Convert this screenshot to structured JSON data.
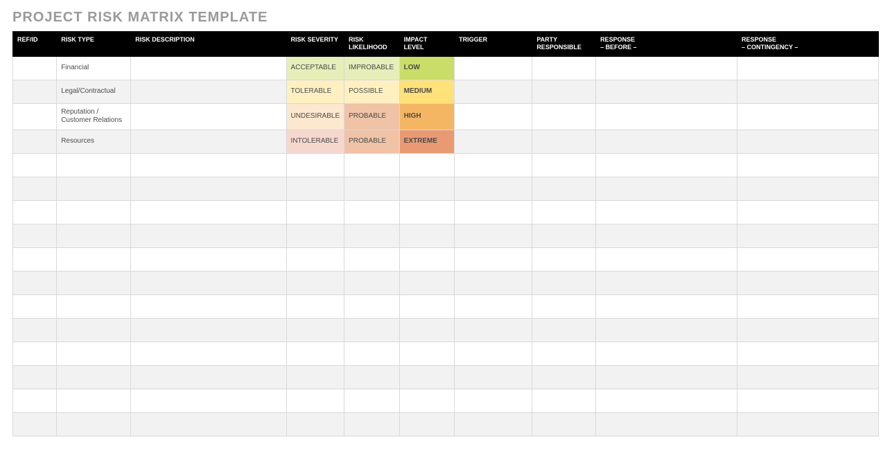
{
  "title": "PROJECT RISK MATRIX TEMPLATE",
  "columns": [
    "REF/ID",
    "RISK TYPE",
    "RISK DESCRIPTION",
    "RISK SEVERITY",
    "RISK LIKELIHOOD",
    "IMPACT LEVEL",
    "TRIGGER",
    "PARTY RESPONSIBLE",
    "RESPONSE – BEFORE –",
    "RESPONSE – CONTINGENCY –"
  ],
  "rows": [
    {
      "ref": "",
      "type": "Financial",
      "desc": "",
      "severity": "ACCEPTABLE",
      "likelihood": "IMPROBABLE",
      "impact": "LOW",
      "sev_bg": "#e6eeb9",
      "lik_bg": "#e6eeb9",
      "imp_bg": "#cadd68",
      "trigger": "",
      "party": "",
      "before": "",
      "contingency": ""
    },
    {
      "ref": "",
      "type": "Legal/Contractual",
      "desc": "",
      "severity": "TOLERABLE",
      "likelihood": "POSSIBLE",
      "impact": "MEDIUM",
      "sev_bg": "#fff0c2",
      "lik_bg": "#fff0c2",
      "imp_bg": "#ffe179",
      "trigger": "",
      "party": "",
      "before": "",
      "contingency": ""
    },
    {
      "ref": "",
      "type": "Reputation / Customer Relations",
      "desc": "",
      "severity": "UNDESIRABLE",
      "likelihood": "PROBABLE",
      "impact": "HIGH",
      "sev_bg": "#fce7cf",
      "lik_bg": "#f0c3a7",
      "imp_bg": "#f5b664",
      "trigger": "",
      "party": "",
      "before": "",
      "contingency": ""
    },
    {
      "ref": "",
      "type": "Resources",
      "desc": "",
      "severity": "INTOLERABLE",
      "likelihood": "PROBABLE",
      "impact": "EXTREME",
      "sev_bg": "#f6d7ce",
      "lik_bg": "#f0c3a7",
      "imp_bg": "#ea9a72",
      "trigger": "",
      "party": "",
      "before": "",
      "contingency": ""
    },
    {
      "ref": "",
      "type": "",
      "desc": "",
      "severity": "",
      "likelihood": "",
      "impact": "",
      "sev_bg": "",
      "lik_bg": "",
      "imp_bg": "",
      "trigger": "",
      "party": "",
      "before": "",
      "contingency": ""
    },
    {
      "ref": "",
      "type": "",
      "desc": "",
      "severity": "",
      "likelihood": "",
      "impact": "",
      "sev_bg": "",
      "lik_bg": "",
      "imp_bg": "",
      "trigger": "",
      "party": "",
      "before": "",
      "contingency": ""
    },
    {
      "ref": "",
      "type": "",
      "desc": "",
      "severity": "",
      "likelihood": "",
      "impact": "",
      "sev_bg": "",
      "lik_bg": "",
      "imp_bg": "",
      "trigger": "",
      "party": "",
      "before": "",
      "contingency": ""
    },
    {
      "ref": "",
      "type": "",
      "desc": "",
      "severity": "",
      "likelihood": "",
      "impact": "",
      "sev_bg": "",
      "lik_bg": "",
      "imp_bg": "",
      "trigger": "",
      "party": "",
      "before": "",
      "contingency": ""
    },
    {
      "ref": "",
      "type": "",
      "desc": "",
      "severity": "",
      "likelihood": "",
      "impact": "",
      "sev_bg": "",
      "lik_bg": "",
      "imp_bg": "",
      "trigger": "",
      "party": "",
      "before": "",
      "contingency": ""
    },
    {
      "ref": "",
      "type": "",
      "desc": "",
      "severity": "",
      "likelihood": "",
      "impact": "",
      "sev_bg": "",
      "lik_bg": "",
      "imp_bg": "",
      "trigger": "",
      "party": "",
      "before": "",
      "contingency": ""
    },
    {
      "ref": "",
      "type": "",
      "desc": "",
      "severity": "",
      "likelihood": "",
      "impact": "",
      "sev_bg": "",
      "lik_bg": "",
      "imp_bg": "",
      "trigger": "",
      "party": "",
      "before": "",
      "contingency": ""
    },
    {
      "ref": "",
      "type": "",
      "desc": "",
      "severity": "",
      "likelihood": "",
      "impact": "",
      "sev_bg": "",
      "lik_bg": "",
      "imp_bg": "",
      "trigger": "",
      "party": "",
      "before": "",
      "contingency": ""
    },
    {
      "ref": "",
      "type": "",
      "desc": "",
      "severity": "",
      "likelihood": "",
      "impact": "",
      "sev_bg": "",
      "lik_bg": "",
      "imp_bg": "",
      "trigger": "",
      "party": "",
      "before": "",
      "contingency": ""
    },
    {
      "ref": "",
      "type": "",
      "desc": "",
      "severity": "",
      "likelihood": "",
      "impact": "",
      "sev_bg": "",
      "lik_bg": "",
      "imp_bg": "",
      "trigger": "",
      "party": "",
      "before": "",
      "contingency": ""
    },
    {
      "ref": "",
      "type": "",
      "desc": "",
      "severity": "",
      "likelihood": "",
      "impact": "",
      "sev_bg": "",
      "lik_bg": "",
      "imp_bg": "",
      "trigger": "",
      "party": "",
      "before": "",
      "contingency": ""
    },
    {
      "ref": "",
      "type": "",
      "desc": "",
      "severity": "",
      "likelihood": "",
      "impact": "",
      "sev_bg": "",
      "lik_bg": "",
      "imp_bg": "",
      "trigger": "",
      "party": "",
      "before": "",
      "contingency": ""
    }
  ],
  "chart_data": {
    "type": "table",
    "title": "PROJECT RISK MATRIX TEMPLATE",
    "columns": [
      "REF/ID",
      "RISK TYPE",
      "RISK DESCRIPTION",
      "RISK SEVERITY",
      "RISK LIKELIHOOD",
      "IMPACT LEVEL",
      "TRIGGER",
      "PARTY RESPONSIBLE",
      "RESPONSE – BEFORE –",
      "RESPONSE – CONTINGENCY –"
    ],
    "data": [
      [
        "",
        "Financial",
        "",
        "ACCEPTABLE",
        "IMPROBABLE",
        "LOW",
        "",
        "",
        "",
        ""
      ],
      [
        "",
        "Legal/Contractual",
        "",
        "TOLERABLE",
        "POSSIBLE",
        "MEDIUM",
        "",
        "",
        "",
        ""
      ],
      [
        "",
        "Reputation / Customer Relations",
        "",
        "UNDESIRABLE",
        "PROBABLE",
        "HIGH",
        "",
        "",
        "",
        ""
      ],
      [
        "",
        "Resources",
        "",
        "INTOLERABLE",
        "PROBABLE",
        "EXTREME",
        "",
        "",
        "",
        ""
      ]
    ]
  }
}
